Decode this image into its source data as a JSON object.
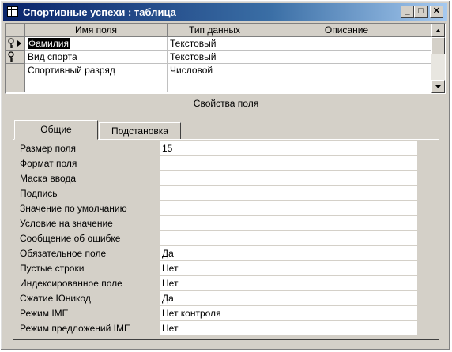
{
  "window": {
    "title": "Спортивные успехи : таблица"
  },
  "titlebar_buttons": {
    "minimize": "_",
    "maximize": "□",
    "close": "✕"
  },
  "grid": {
    "columns": [
      "Имя поля",
      "Тип данных",
      "Описание"
    ],
    "rows": [
      {
        "name": "Фамилия",
        "type": "Текстовый",
        "description": "",
        "key": true,
        "current": true
      },
      {
        "name": "Вид спорта",
        "type": "Текстовый",
        "description": "",
        "key": true,
        "current": false
      },
      {
        "name": "Спортивный разряд",
        "type": "Числовой",
        "description": "",
        "key": false,
        "current": false
      },
      {
        "name": "",
        "type": "",
        "description": "",
        "key": false,
        "current": false
      }
    ]
  },
  "properties_label": "Свойства поля",
  "tabs": [
    {
      "label": "Общие",
      "active": true
    },
    {
      "label": "Подстановка",
      "active": false
    }
  ],
  "properties": [
    {
      "label": "Размер поля",
      "value": "15"
    },
    {
      "label": "Формат поля",
      "value": ""
    },
    {
      "label": "Маска ввода",
      "value": ""
    },
    {
      "label": "Подпись",
      "value": ""
    },
    {
      "label": "Значение по умолчанию",
      "value": ""
    },
    {
      "label": "Условие на значение",
      "value": ""
    },
    {
      "label": "Сообщение об ошибке",
      "value": ""
    },
    {
      "label": "Обязательное поле",
      "value": "Да"
    },
    {
      "label": "Пустые строки",
      "value": "Нет"
    },
    {
      "label": "Индексированное поле",
      "value": "Нет"
    },
    {
      "label": "Сжатие Юникод",
      "value": "Да"
    },
    {
      "label": "Режим IME",
      "value": "Нет контроля"
    },
    {
      "label": "Режим предложений IME",
      "value": "Нет"
    }
  ],
  "colors": {
    "titlebar_start": "#0a246a",
    "titlebar_end": "#a6caf0",
    "face": "#d4d0c8",
    "selection": "#000000"
  }
}
